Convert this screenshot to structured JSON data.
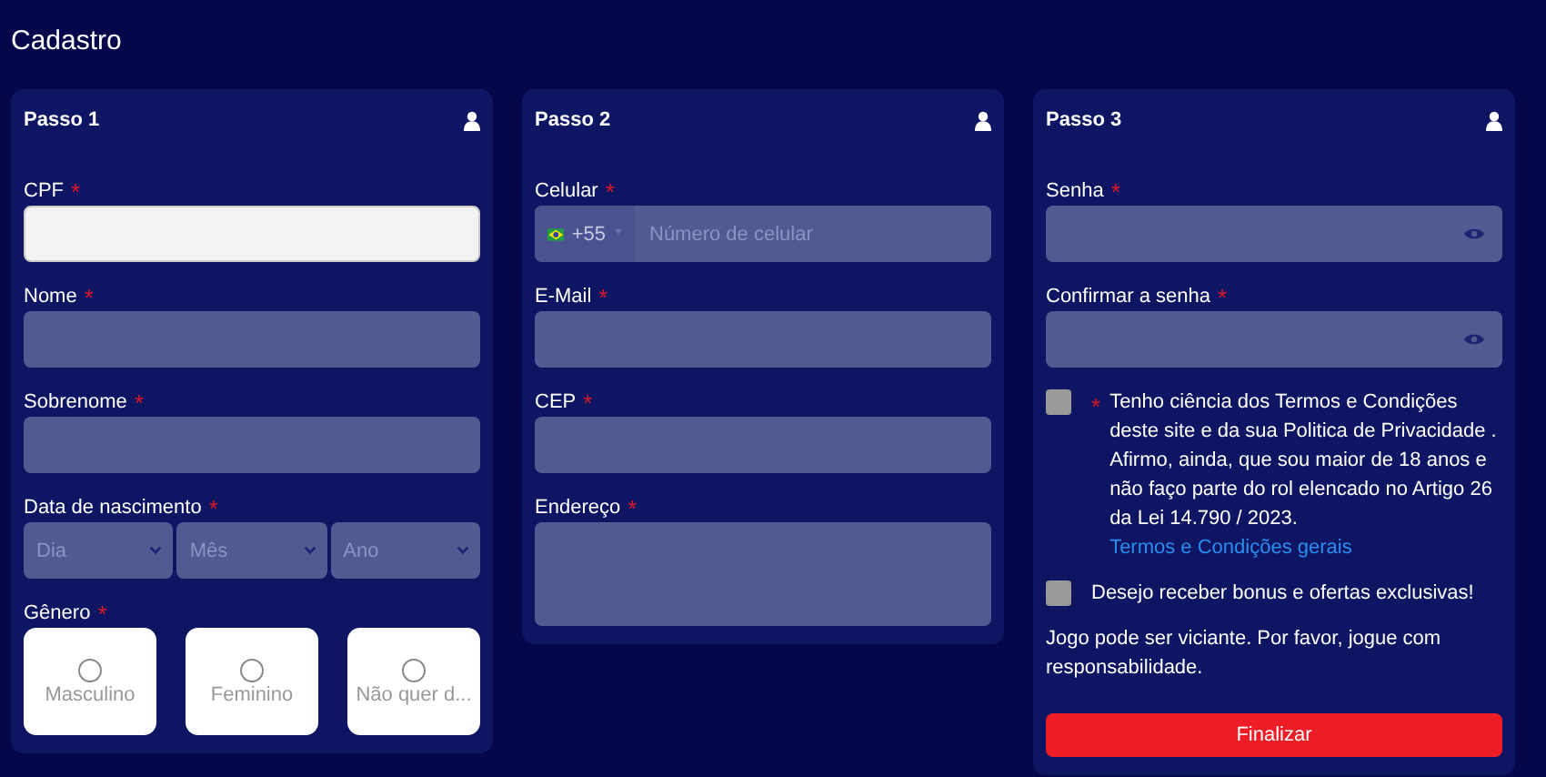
{
  "title": "Cadastro",
  "required_mark": "*",
  "steps": [
    {
      "title": "Passo 1",
      "fields": [
        {
          "kind": "text",
          "label": "CPF",
          "required": true,
          "focused": true
        },
        {
          "kind": "text",
          "label": "Nome",
          "required": true,
          "focused": false
        },
        {
          "kind": "text",
          "label": "Sobrenome",
          "required": true,
          "focused": false
        },
        {
          "kind": "selects",
          "label": "Data de nascimento",
          "required": true,
          "options": [
            "Dia",
            "Mês",
            "Ano"
          ]
        },
        {
          "kind": "radios",
          "label": "Gênero",
          "required": true,
          "options": [
            {
              "label": "Masculino",
              "selected": false
            },
            {
              "label": "Feminino",
              "selected": false
            },
            {
              "label": "Não quer d...",
              "selected": false
            }
          ]
        }
      ]
    },
    {
      "title": "Passo 2",
      "fields": [
        {
          "kind": "phone",
          "label": "Celular",
          "required": true,
          "code": "+55",
          "placeholder": "Número de celular"
        },
        {
          "kind": "text",
          "label": "E-Mail",
          "required": true,
          "focused": false
        },
        {
          "kind": "text",
          "label": "CEP",
          "required": true,
          "focused": false
        },
        {
          "kind": "textarea",
          "label": "Endereço",
          "required": true
        }
      ]
    },
    {
      "title": "Passo 3",
      "fields": [
        {
          "kind": "password",
          "label": "Senha",
          "required": true
        },
        {
          "kind": "password",
          "label": "Confirmar a senha",
          "required": true
        },
        {
          "kind": "checkbox",
          "required": true,
          "checked": false,
          "text": "Tenho ciência dos Termos e Condições deste site e da sua Politica de Privacidade . Afirmo, ainda, que sou maior de 18 anos e não faço parte do rol elencado no Artigo 26 da Lei 14.790 / 2023.",
          "link": "Termos e Condições gerais"
        },
        {
          "kind": "checkbox",
          "required": false,
          "checked": false,
          "text": "Desejo receber bonus e ofertas exclusivas!"
        },
        {
          "kind": "note",
          "text": "Jogo pode ser viciante. Por favor, jogue com responsabilidade."
        },
        {
          "kind": "button",
          "text": "Finalizar"
        }
      ]
    }
  ]
}
